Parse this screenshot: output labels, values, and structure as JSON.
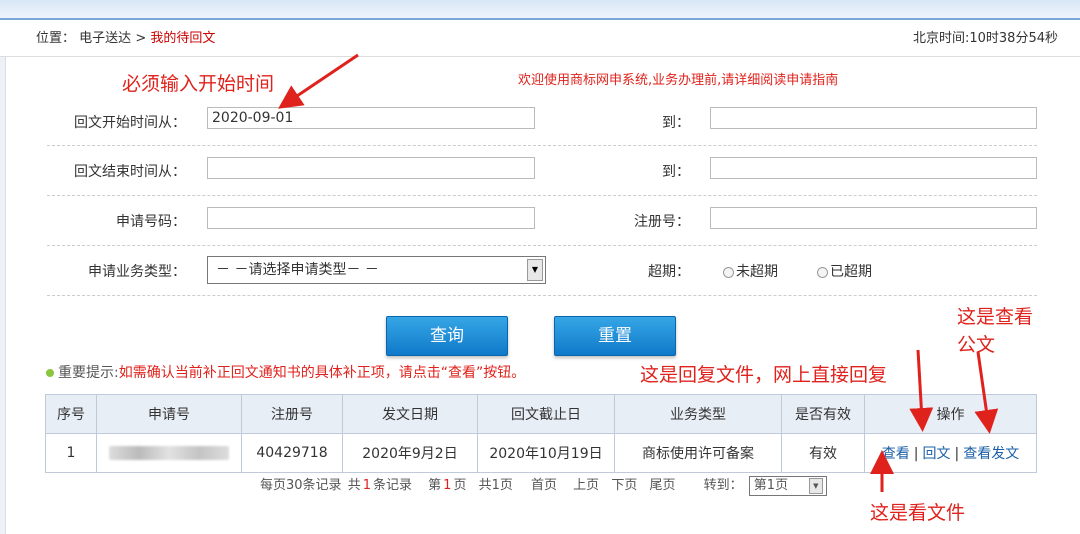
{
  "breadcrumb": {
    "prefix": "位置：",
    "level1": "电子送达",
    "sep": ">",
    "current": "我的待回文"
  },
  "clock": "北京时间:10时38分54秒",
  "annotations": {
    "start_time_note": "必须输入开始时间",
    "reply_note": "这是回复文件，网上直接回复",
    "view_doc_note": "这是查看公文",
    "view_file_note": "这是看文件"
  },
  "welcome": "欢迎使用商标网申系统,业务办理前,请详细阅读申请指南",
  "form": {
    "reply_start_from_label": "回文开始时间从：",
    "reply_start_from_value": "2020-09-01",
    "to_label_1": "到：",
    "to_value_1": "",
    "reply_end_from_label": "回文结束时间从：",
    "reply_end_from_value": "",
    "to_label_2": "到：",
    "to_value_2": "",
    "app_no_label": "申请号码：",
    "app_no_value": "",
    "reg_no_label": "注册号：",
    "reg_no_value": "",
    "biz_type_label": "申请业务类型：",
    "biz_type_selected": "－ －请选择申请类型－ －",
    "overdue_label": "超期：",
    "overdue_options": [
      "未超期",
      "已超期"
    ]
  },
  "buttons": {
    "query": "查询",
    "reset": "重置"
  },
  "tip": {
    "label": "重要提示:",
    "text": "如需确认当前补正回文通知书的具体补正项，请点击“查看”按钮。"
  },
  "table": {
    "headers": [
      "序号",
      "申请号",
      "注册号",
      "发文日期",
      "回文截止日",
      "业务类型",
      "是否有效",
      "操作"
    ],
    "rows": [
      {
        "index": "1",
        "reg_no": "40429718",
        "issue_date": "2020年9月2日",
        "deadline": "2020年10月19日",
        "biz_type": "商标使用许可备案",
        "valid": "有效",
        "actions": [
          "查看",
          "回文",
          "查看发文"
        ]
      }
    ],
    "action_sep": "|"
  },
  "pager": {
    "per_page": "每页30条记录",
    "total_prefix": "共",
    "total_count": "1",
    "total_suffix": "条记录",
    "current_prefix": "第",
    "current_page": "1",
    "current_suffix": "页",
    "pages_text": "共1页",
    "first": "首页",
    "prev": "上页",
    "next": "下页",
    "last": "尾页",
    "goto_label": "转到：",
    "goto_selected": "第1页"
  },
  "colors": {
    "accent_red": "#e0221c",
    "link_blue": "#1a5fa8",
    "button_blue": "#1a8ad6"
  }
}
